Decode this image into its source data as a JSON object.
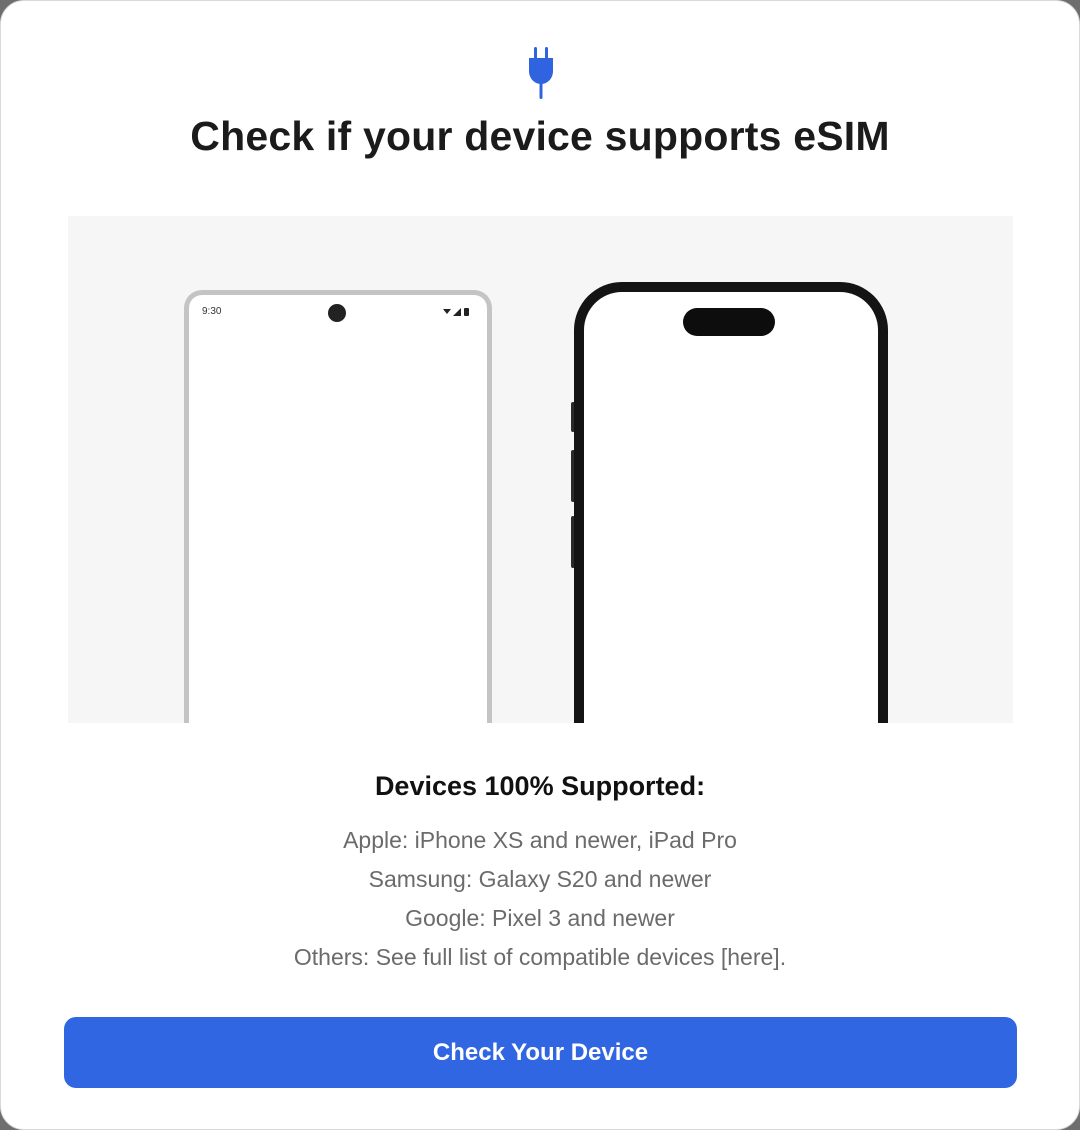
{
  "header": {
    "icon": "plug-icon",
    "title": "Check if your device supports eSIM"
  },
  "hero": {
    "android": {
      "status_time": "9:30",
      "status_icons": "wifi-signal-battery-icons"
    },
    "iphone": {
      "notch": "dynamic-island"
    }
  },
  "devices": {
    "heading": "Devices 100% Supported:",
    "items": [
      "Apple: iPhone XS and newer, iPad Pro",
      "Samsung: Galaxy S20 and newer",
      "Google: Pixel 3 and newer",
      "Others: See full list of compatible devices [here]."
    ]
  },
  "cta": {
    "label": "Check Your Device"
  },
  "colors": {
    "accent": "#3166e3",
    "title": "#1b1b1b",
    "muted_text": "#6b6b6b",
    "hero_bg": "#f6f6f6"
  }
}
